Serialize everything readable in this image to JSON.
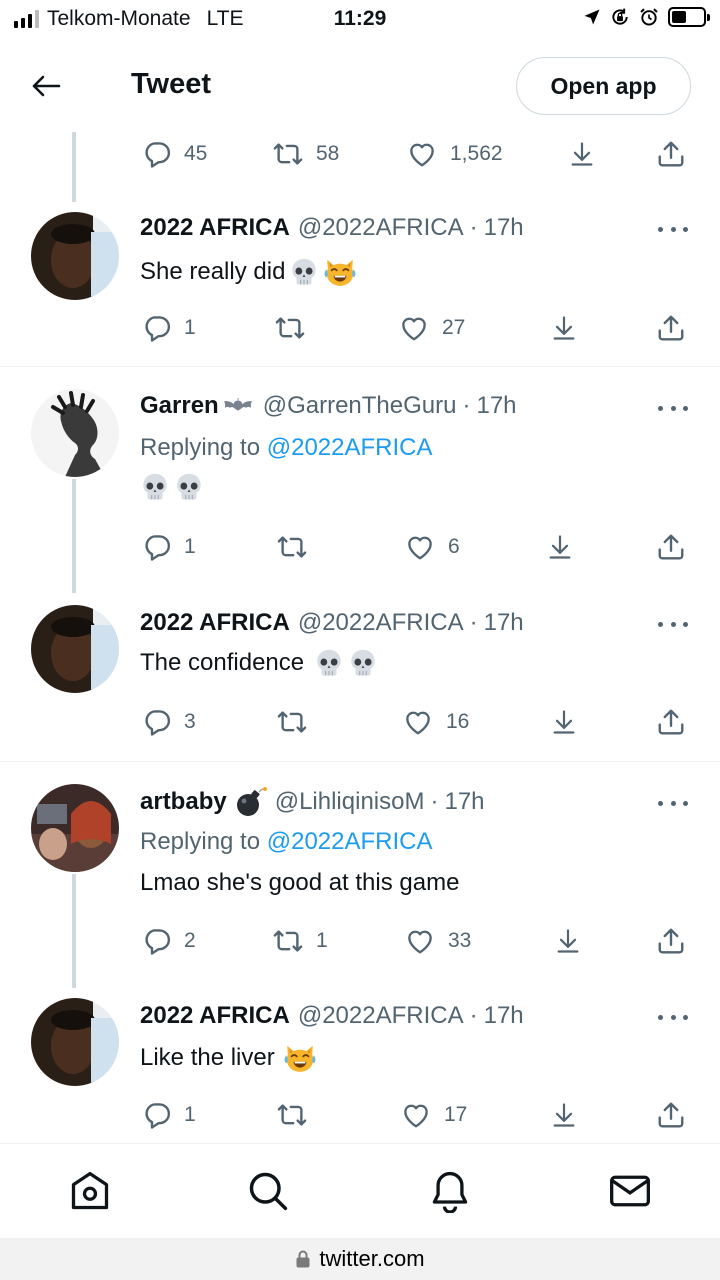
{
  "status_bar": {
    "carrier": "Telkom-Monate",
    "network": "LTE",
    "time": "11:29",
    "icons": [
      "signal-icon",
      "location-arrow-icon",
      "rotation-lock-icon",
      "alarm-icon",
      "battery-icon"
    ]
  },
  "header": {
    "title": "Tweet",
    "back_icon": "arrow-left-icon",
    "open_app_label": "Open app"
  },
  "top_actions": {
    "replies": "45",
    "retweets": "58",
    "likes": "1,562"
  },
  "tweets": [
    {
      "name": "2022 AFRICA",
      "handle": "@2022AFRICA",
      "time": "17h",
      "text": "She really did",
      "emojis": [
        "skull",
        "crying-laughing-cat"
      ],
      "replies": "1",
      "retweets": "",
      "likes": "27"
    },
    {
      "name": "Garren",
      "name_emoji": "bat",
      "handle": "@GarrenTheGuru",
      "time": "17h",
      "replying_prefix": "Replying to",
      "replying_to": "@2022AFRICA",
      "text": "",
      "emojis": [
        "skull",
        "skull"
      ],
      "replies": "1",
      "retweets": "",
      "likes": "6"
    },
    {
      "name": "2022 AFRICA",
      "handle": "@2022AFRICA",
      "time": "17h",
      "text": "The confidence",
      "emojis": [
        "skull",
        "skull"
      ],
      "replies": "3",
      "retweets": "",
      "likes": "16"
    },
    {
      "name": "artbaby",
      "name_emoji": "bomb",
      "handle": "@LihliqinisoM",
      "time": "17h",
      "replying_prefix": "Replying to",
      "replying_to": "@2022AFRICA",
      "text": "Lmao she's good at this game",
      "replies": "2",
      "retweets": "1",
      "likes": "33"
    },
    {
      "name": "2022 AFRICA",
      "handle": "@2022AFRICA",
      "time": "17h",
      "text": "Like the liver",
      "emojis": [
        "crying-laughing-cat"
      ],
      "replies": "1",
      "retweets": "",
      "likes": "17"
    }
  ],
  "bottom_nav": [
    "home-icon",
    "search-icon",
    "notifications-bell-icon",
    "messages-envelope-icon"
  ],
  "url_bar": {
    "url": "twitter.com"
  },
  "colors": {
    "text": "#0f1419",
    "secondary": "#536471",
    "link": "#1d9bf0",
    "border": "#eff3f4"
  }
}
